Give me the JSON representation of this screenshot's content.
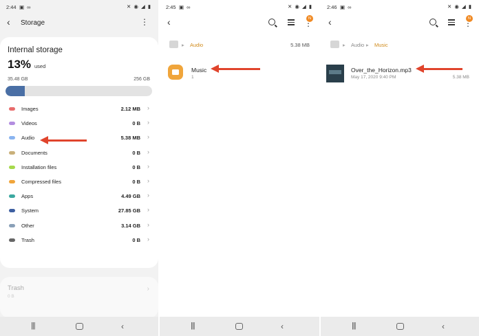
{
  "screen1": {
    "status": {
      "time": "2:44",
      "left_icons": "▣ ∞",
      "right_icons": "✕ ◉ ◢ ▮"
    },
    "appbar": {
      "title": "Storage"
    },
    "card": {
      "title": "Internal storage",
      "percent": "13%",
      "percent_suffix": "used",
      "used": "35.48 GB",
      "total": "256 GB",
      "used_fraction": 0.13
    },
    "categories": [
      {
        "name": "Images",
        "value": "2.12 MB",
        "color": "#e86c6c"
      },
      {
        "name": "Videos",
        "value": "0 B",
        "color": "#b38de0"
      },
      {
        "name": "Audio",
        "value": "5.38 MB",
        "color": "#8ab4f0"
      },
      {
        "name": "Documents",
        "value": "0 B",
        "color": "#c9b07a"
      },
      {
        "name": "Installation files",
        "value": "0 B",
        "color": "#a6d94c"
      },
      {
        "name": "Compressed files",
        "value": "0 B",
        "color": "#f0a53b"
      },
      {
        "name": "Apps",
        "value": "4.49 GB",
        "color": "#3ba8a0"
      },
      {
        "name": "System",
        "value": "27.85 GB",
        "color": "#3d5fa0"
      },
      {
        "name": "Other",
        "value": "3.14 GB",
        "color": "#8aa0b8"
      },
      {
        "name": "Trash",
        "value": "0 B",
        "color": "#666666"
      }
    ],
    "trash": {
      "title": "Trash",
      "value": "0 B"
    }
  },
  "screen2": {
    "status": {
      "time": "2:45",
      "left_icons": "▣ ∞",
      "right_icons": "✕ ◉ ◢ ▮"
    },
    "badge": "N",
    "crumb": {
      "segment": "Audio",
      "size": "5.38 MB"
    },
    "folder": {
      "name": "Music",
      "count": "1"
    }
  },
  "screen3": {
    "status": {
      "time": "2:46",
      "left_icons": "▣ ∞",
      "right_icons": "✕ ◉ ◢ ▮"
    },
    "badge": "N",
    "crumb": {
      "segment1": "Audio",
      "segment2": "Music"
    },
    "file": {
      "name": "Over_the_Horizon.mp3",
      "date": "May 17, 2020 9:40 PM",
      "size": "5.38 MB"
    }
  },
  "colors": {
    "accent_orange": "#f0a53b",
    "crumb_active": "#d08a1a",
    "arrow": "#e0442c"
  }
}
